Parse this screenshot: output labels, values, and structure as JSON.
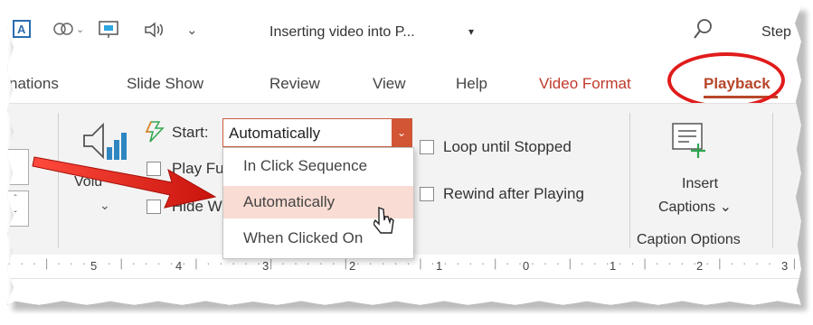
{
  "titlebar": {
    "doc_title": "Inserting video into P...",
    "title_caret": "▾",
    "user": "Step",
    "qat_more": "⌄"
  },
  "tabs": {
    "animations": "nations",
    "slide_show": "Slide Show",
    "review": "Review",
    "view": "View",
    "help": "Help",
    "video_format": "Video Format",
    "playback": "Playback"
  },
  "ribbon": {
    "volume_label": "Volu",
    "volume_chevron": "⌄",
    "start_label": "Start:",
    "start_value": "Automatically",
    "start_dropdown_glyph": "⌄",
    "play_fullscreen_label": "Play Fu",
    "hide_label": "Hide W",
    "loop_label": "Loop until Stopped",
    "rewind_label": "Rewind after Playing",
    "insert_captions_line1": "Insert",
    "insert_captions_line2": "Captions ⌄",
    "caption_group_label": "Caption Options"
  },
  "dropdown": {
    "options": [
      "In Click Sequence",
      "Automatically",
      "When Clicked On"
    ],
    "selected_index": 1
  },
  "ruler": {
    "marks": [
      "5",
      "4",
      "3",
      "2",
      "1",
      "0",
      "1",
      "2",
      "3"
    ]
  },
  "colors": {
    "accent": "#b7472a",
    "highlight_ellipse": "#e11b1b",
    "selected_option_bg": "#f9dcd3"
  }
}
